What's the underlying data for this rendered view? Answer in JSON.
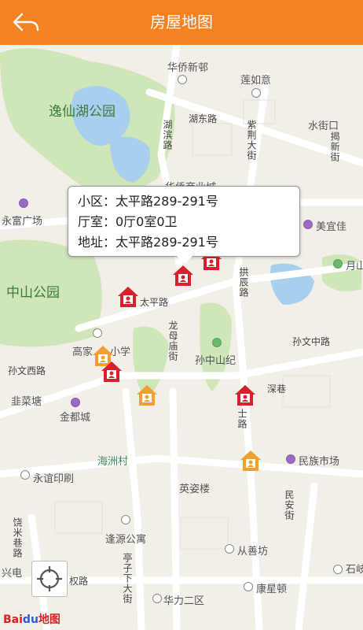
{
  "header": {
    "title": "房屋地图",
    "back_icon": "back-arrow-icon"
  },
  "popup": {
    "community": "小区：太平路289-291号",
    "rooms": "厅室：0厅0室0卫",
    "address": "地址：太平路289-291号"
  },
  "map_labels": {
    "park1": "逸仙湖公园",
    "park2": "中山公园",
    "huaqiao": "华侨新邨",
    "lianruyi": "莲如意",
    "hudong": "湖东路",
    "hubin": "湖滨路",
    "zijin": "紫荆大街",
    "shuijie": "水街口",
    "jieximen": "揭新街",
    "huaqiaoshang": "华侨商业城",
    "yongfu": "永富广场",
    "meiyi": "美宜佳",
    "yueshan": "月山",
    "taiping": "太平路",
    "gongchen": "拱辰路",
    "longmu": "龙母庙街",
    "sunzhongshan": "孙中山纪",
    "gaojia": "高家",
    "xiaoxue": "小学",
    "sunwenxi": "孙文西路",
    "sunwenzhong": "孙文中路",
    "jiucai": "韭菜塘",
    "jindu": "金都城",
    "shenxiang": "深巷",
    "shilu": "士路",
    "haizhou": "海洲村",
    "minzu": "民族市场",
    "yongyi": "永谊印刷",
    "yingzi": "英姿楼",
    "minan": "民安街",
    "jiumi": "饶米巷路",
    "fengyuan": "逢源公寓",
    "tingzi": "亭子下大街",
    "congshan": "从善坊",
    "shiqi": "石岐",
    "xingdian": "兴电",
    "quanlu": "权路",
    "kangxing": "康星顿",
    "huali": "华力二区"
  },
  "locate_icon": "locate-crosshair-icon",
  "logo": {
    "bai": "Bai",
    "du": "du",
    "map": "地图"
  },
  "colors": {
    "header": "#f58220",
    "marker_red": "#d8202a",
    "marker_orange": "#f0a030",
    "park": "#cfe6b8",
    "water": "#a8d0ee"
  }
}
